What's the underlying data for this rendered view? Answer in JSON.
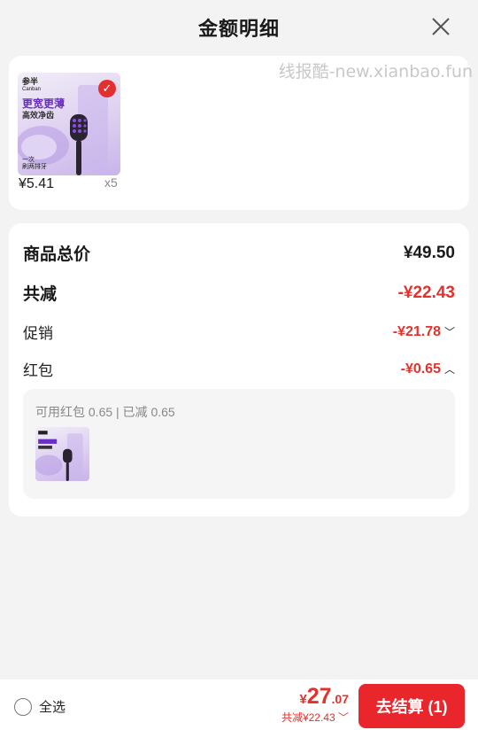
{
  "header": {
    "title": "金额明细",
    "close_icon": "close-icon"
  },
  "watermark": "线报酷-new.xianbao.fun",
  "product": {
    "thumbnail": {
      "brand": "参半",
      "brand_sub": "Canban",
      "headline": "更宽更薄",
      "subline": "高效净齿",
      "bottom_line1": "一次",
      "bottom_line2": "刷两排牙",
      "check_icon": "check-circle-icon"
    },
    "price": "¥5.41",
    "quantity": "x5"
  },
  "summary": {
    "total_label": "商品总价",
    "total_value": "¥49.50",
    "reduce_label": "共减",
    "reduce_value": "-¥22.43",
    "promo_label": "促销",
    "promo_value": "-¥21.78",
    "promo_chevron": "chevron-down-icon",
    "coupon_label": "红包",
    "coupon_value": "-¥0.65",
    "coupon_chevron": "chevron-up-icon",
    "coupon_detail": "可用红包 0.65 | 已减 0.65"
  },
  "bottom": {
    "select_all": "全选",
    "price_currency": "¥",
    "price_integer": "27",
    "price_decimal": ".07",
    "reduce_text": "共减¥22.43",
    "checkout": "去结算 (1)"
  },
  "colors": {
    "accent_red": "#e5302b",
    "button_red": "#e8262c",
    "background": "#f3f3f3"
  }
}
